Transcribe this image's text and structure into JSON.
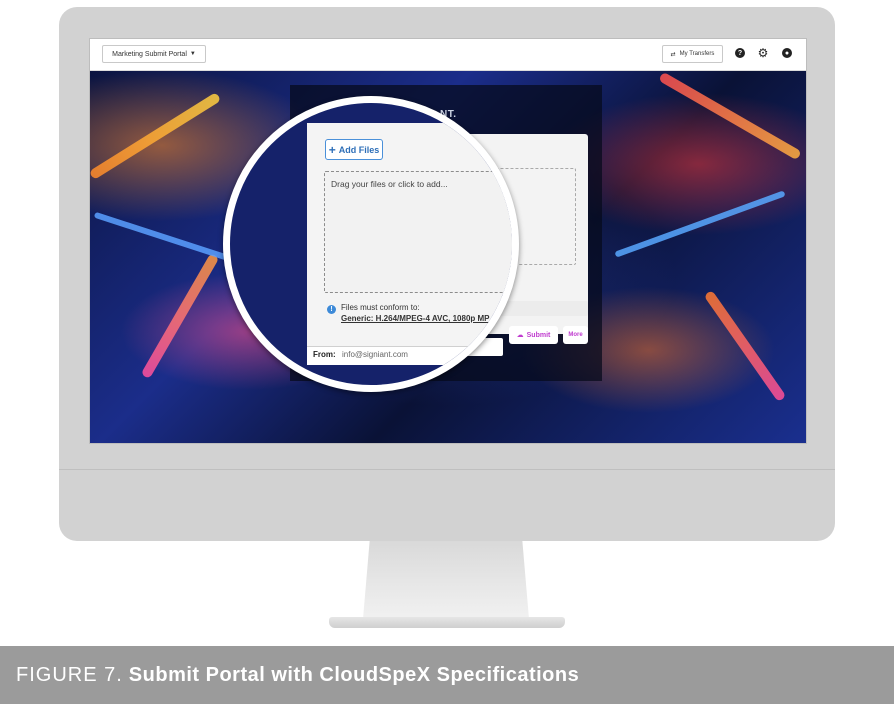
{
  "topbar": {
    "portal_selector": "Marketing Submit Portal",
    "transfers_label": "My Transfers"
  },
  "portal": {
    "logo_text": "NT.",
    "add_files_label": "Add Files",
    "drop_hint": "Drag your files or click to add...",
    "conform_label": "Files must conform to:",
    "spec_link": "Generic: H.264/MPEG-4 AVC, 1080p MP",
    "from_label": "From:",
    "from_value": "info@signiant.com",
    "submit_label": "Submit",
    "more_label": "More"
  },
  "icons": {
    "transfers": "swap-arrows-icon",
    "help": "help-icon",
    "settings": "gear-icon",
    "account": "user-icon",
    "info": "info-icon",
    "submit": "upload-cloud-icon"
  },
  "colors": {
    "accent_blue": "#3d8ad8",
    "submit_magenta": "#c03ccf",
    "caption_bg": "#9b9b9b"
  },
  "caption": {
    "prefix": "FIGURE 7.",
    "title": "Submit Portal with CloudSpeX Specifications"
  }
}
